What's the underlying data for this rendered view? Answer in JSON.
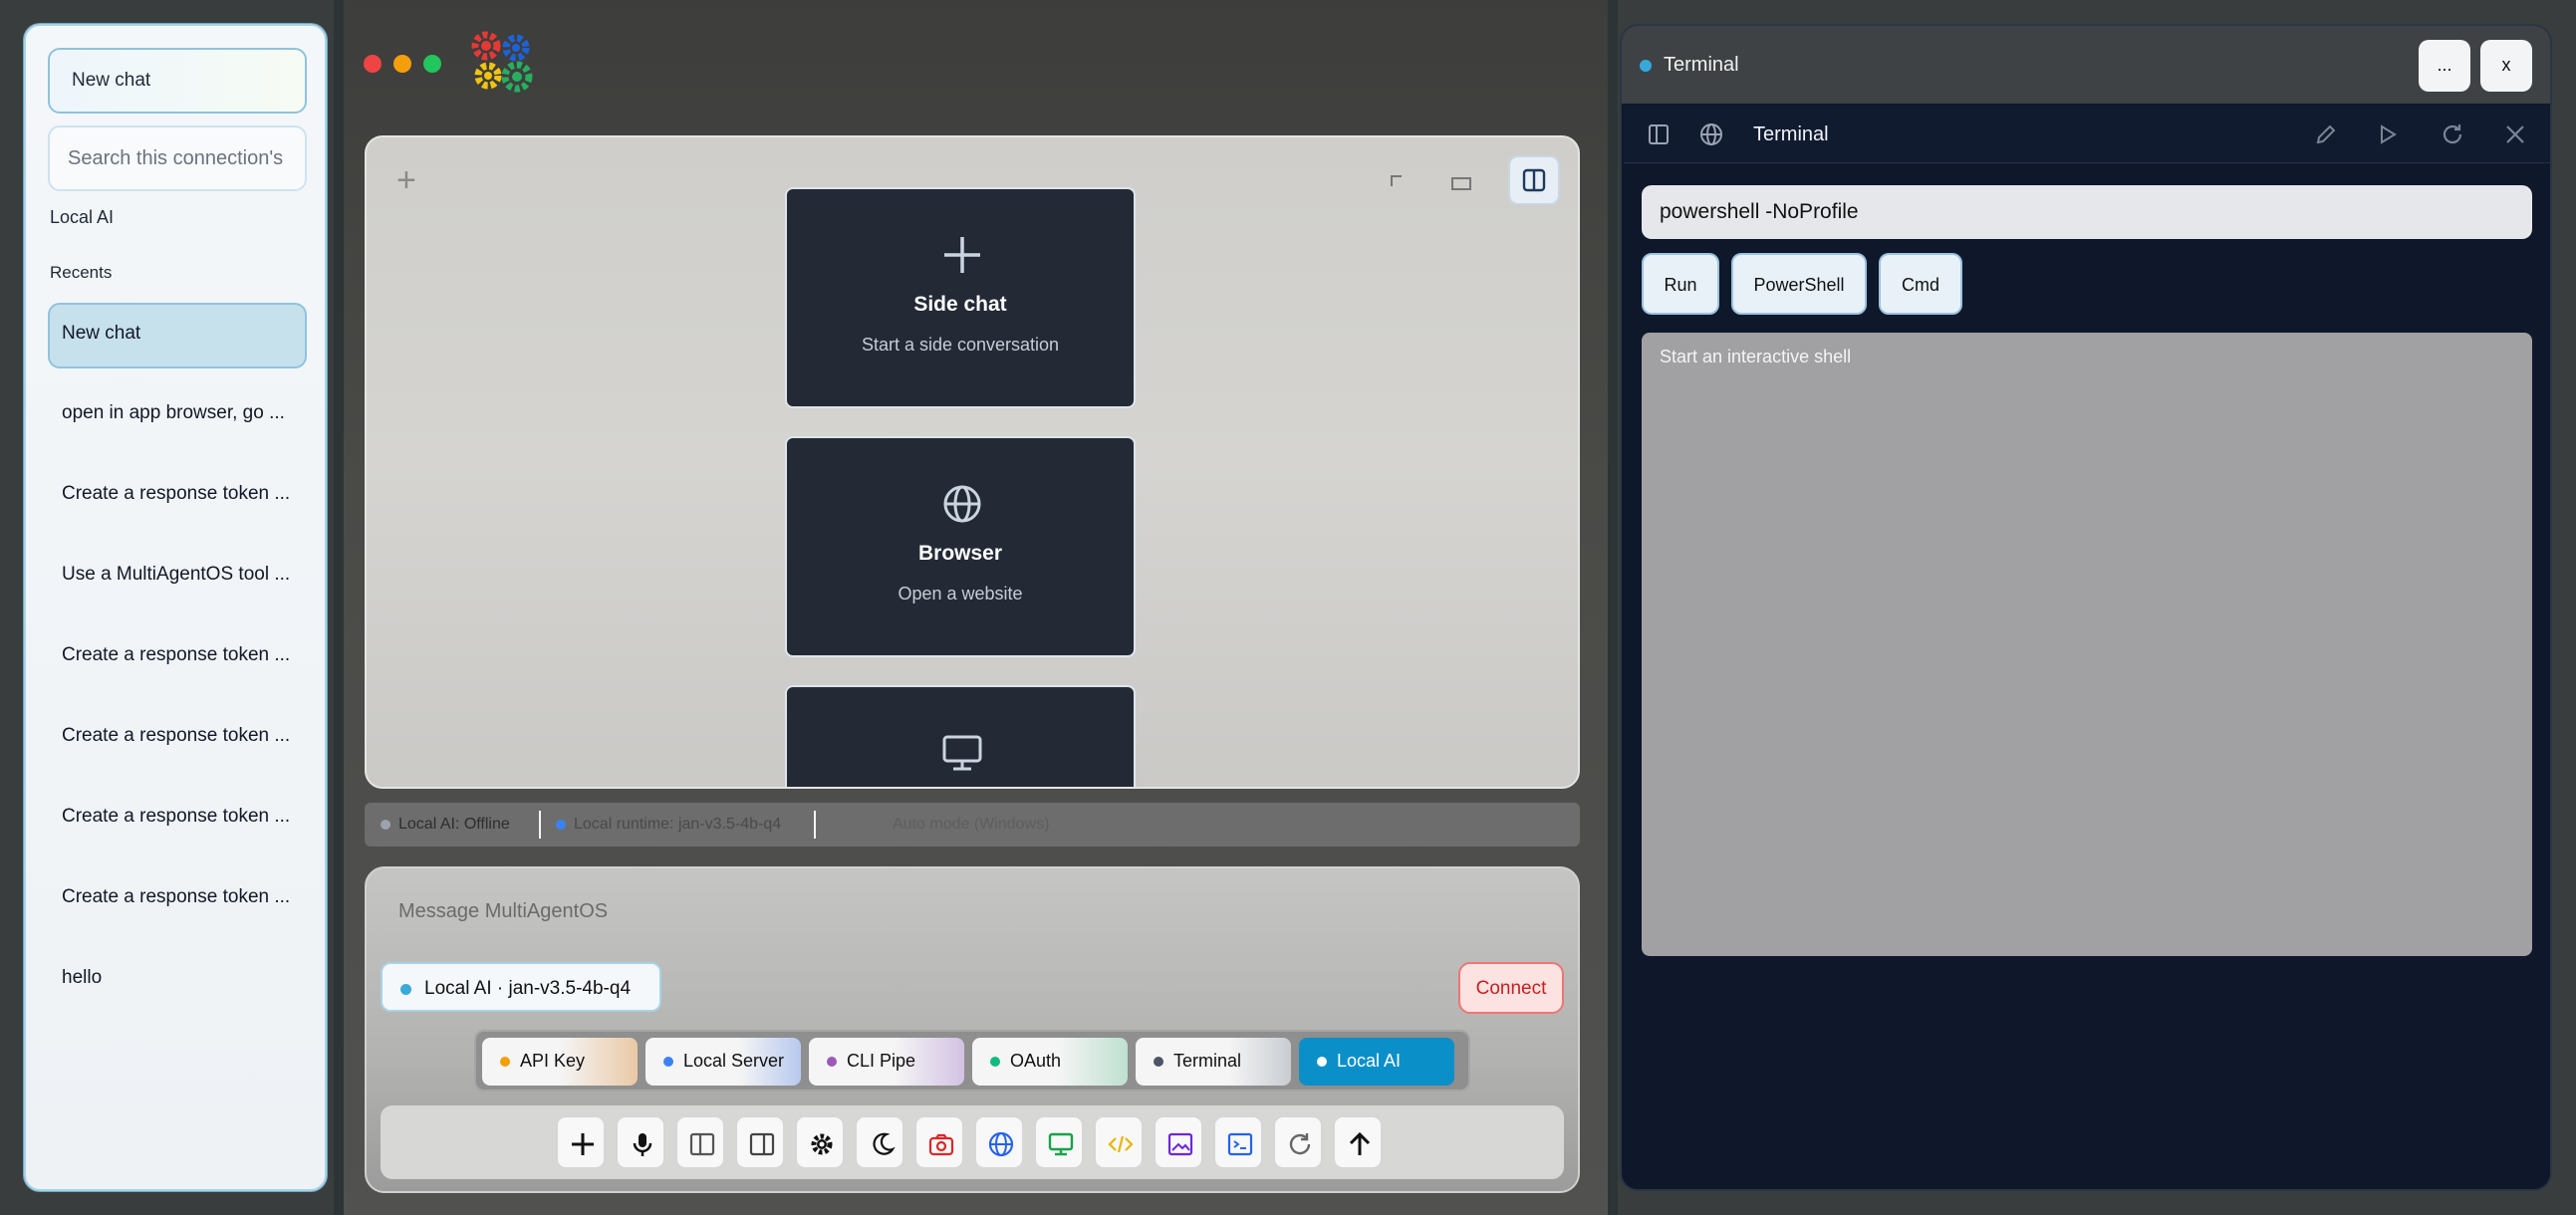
{
  "sidebar": {
    "new_chat_button": "New chat",
    "search_placeholder": "Search this connection's",
    "connection_label": "Local AI",
    "recents_label": "Recents",
    "recents": [
      "New chat",
      "open in app browser, go ...",
      "Create a response token ...",
      "Use a MultiAgentOS tool ...",
      "Create a response token ...",
      "Create a response token ...",
      "Create a response token ...",
      "Create a response token ...",
      "hello"
    ]
  },
  "cards": [
    {
      "title": "Side chat",
      "subtitle": "Start a side conversation",
      "icon": "plus-icon"
    },
    {
      "title": "Browser",
      "subtitle": "Open a website",
      "icon": "globe-icon"
    },
    {
      "title": "",
      "subtitle": "",
      "icon": "monitor-icon"
    }
  ],
  "status": {
    "local_ai": "Local AI: Offline",
    "runtime": "Local runtime: jan-v3.5-4b-q4",
    "extra": "Auto mode (Windows)"
  },
  "composer": {
    "placeholder": "Message MultiAgentOS",
    "model": "Local AI · jan-v3.5-4b-q4",
    "connect": "Connect"
  },
  "connection_tabs": [
    {
      "label": "API Key",
      "color": "#f59e0b"
    },
    {
      "label": "Local Server",
      "color": "#3b82f6"
    },
    {
      "label": "CLI Pipe",
      "color": "#9b59b6"
    },
    {
      "label": "OAuth",
      "color": "#10b981"
    },
    {
      "label": "Terminal",
      "color": "#4b5563"
    },
    {
      "label": "Local AI",
      "color": "#ffffff",
      "active": true
    }
  ],
  "toolbar_icons": [
    "plus-icon",
    "microphone-icon",
    "split-left-icon",
    "split-right-icon",
    "gear-icon",
    "moon-icon",
    "camera-icon",
    "globe-icon",
    "monitor-icon",
    "code-icon",
    "image-icon",
    "terminal-icon",
    "refresh-icon",
    "arrow-up-icon"
  ],
  "terminal": {
    "window_title": "Terminal",
    "more_label": "...",
    "close_label": "x",
    "panel_title": "Terminal",
    "command": "powershell -NoProfile",
    "buttons": [
      "Run",
      "PowerShell",
      "Cmd"
    ],
    "output_placeholder": "Start an interactive shell"
  },
  "colors": {
    "accent": "#0ea5e9",
    "active_tab": "#0b8fc9",
    "card_bg": "#232a35",
    "terminal_bg": "#0f172a"
  }
}
